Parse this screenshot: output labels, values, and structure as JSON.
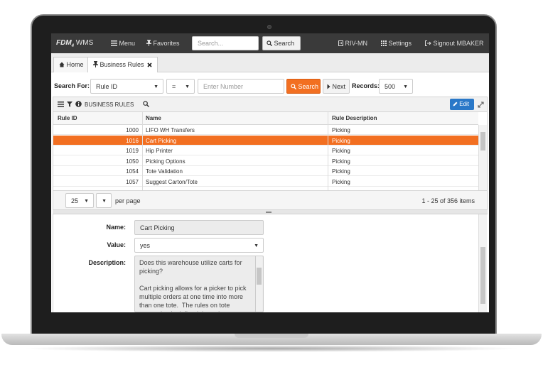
{
  "navbar": {
    "brand_main": "FDM",
    "brand_sub": "4",
    "brand_suffix": " WMS",
    "menu_label": "Menu",
    "favorites_label": "Favorites",
    "search_placeholder": "Search...",
    "search_button": "Search",
    "location_label": "RIV-MN",
    "settings_label": "Settings",
    "signout_label": "Signout MBAKER"
  },
  "tabs": {
    "home_label": "Home",
    "business_rules_label": "Business Rules"
  },
  "search_bar": {
    "search_for_label": "Search For:",
    "field_value": "Rule ID",
    "operator_value": "=",
    "number_placeholder": "Enter Number",
    "search_button": "Search",
    "next_button": "Next",
    "records_label": "Records:",
    "records_value": "500"
  },
  "grid_toolbar": {
    "title": "BUSINESS RULES",
    "edit_button": "Edit"
  },
  "grid": {
    "columns": [
      "Rule ID",
      "Name",
      "Rule Description"
    ],
    "rows": [
      {
        "id": "1000",
        "name": "LIFO WH Transfers",
        "desc": "Picking"
      },
      {
        "id": "1016",
        "name": "Cart Picking",
        "desc": "Picking"
      },
      {
        "id": "1019",
        "name": "Hip Printer",
        "desc": "Picking"
      },
      {
        "id": "1050",
        "name": "Picking Options",
        "desc": "Picking"
      },
      {
        "id": "1054",
        "name": "Tote Validation",
        "desc": "Picking"
      },
      {
        "id": "1057",
        "name": "Suggest Carton/Tote",
        "desc": "Picking"
      }
    ],
    "selected_row": 1
  },
  "pager": {
    "page_size": "25",
    "per_page_label": "per page",
    "summary": "1 - 25 of 356 items"
  },
  "detail": {
    "name_label": "Name:",
    "name_value": "Cart Picking",
    "value_label": "Value:",
    "value_value": "yes",
    "description_label": "Description:",
    "description_text": "Does this warehouse utilize carts for picking?\n\nCart picking allows for a picker to pick multiple orders at one time into more than one tote.  The rules on tote separation is defined through system"
  },
  "colors": {
    "accent_orange": "#f26f21",
    "edit_blue": "#2a78c8",
    "navbar_bg": "#3a3a3a"
  },
  "icons": [
    "menu-icon",
    "pin-icon",
    "search-icon",
    "building-icon",
    "grid-icon",
    "signout-icon",
    "home-icon",
    "close-icon",
    "hamburger-icon",
    "filter-icon",
    "info-icon",
    "pencil-icon",
    "expand-icon",
    "caret-down-icon",
    "chevron-right-icon"
  ]
}
